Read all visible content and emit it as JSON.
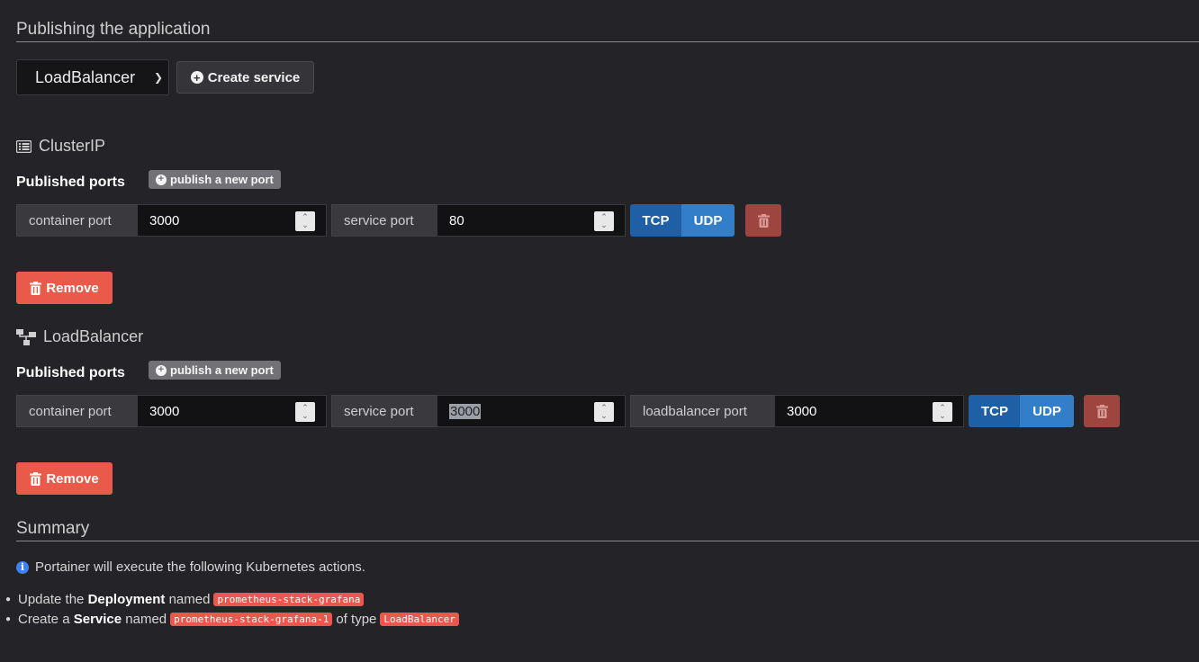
{
  "publishing": {
    "title": "Publishing the application",
    "service_type_selected": "LoadBalancer",
    "create_service_label": "Create service"
  },
  "services": [
    {
      "type": "ClusterIP",
      "icon": "list-icon",
      "published_ports_label": "Published ports",
      "publish_new_port_label": "publish a new port",
      "ports": [
        {
          "container_port_label": "container port",
          "container_port_value": "3000",
          "service_port_label": "service port",
          "service_port_value": "80",
          "tcp_label": "TCP",
          "udp_label": "UDP"
        }
      ],
      "remove_label": "Remove"
    },
    {
      "type": "LoadBalancer",
      "icon": "sitemap-icon",
      "published_ports_label": "Published ports",
      "publish_new_port_label": "publish a new port",
      "ports": [
        {
          "container_port_label": "container port",
          "container_port_value": "3000",
          "service_port_label": "service port",
          "service_port_value": "3000",
          "loadbalancer_port_label": "loadbalancer port",
          "loadbalancer_port_value": "3000",
          "tcp_label": "TCP",
          "udp_label": "UDP"
        }
      ],
      "remove_label": "Remove"
    }
  ],
  "summary": {
    "title": "Summary",
    "info_text": "Portainer will execute the following Kubernetes actions.",
    "actions": [
      {
        "verb": "Update the",
        "kind": "Deployment",
        "named_text": "named",
        "name": "prometheus-stack-grafana"
      },
      {
        "verb": "Create a",
        "kind": "Service",
        "named_text": "named",
        "name": "prometheus-stack-grafana-1",
        "of_type_text": "of type",
        "type": "LoadBalancer"
      }
    ]
  },
  "colors": {
    "background": "#242327",
    "primary_dark": "#1f5fa6",
    "primary": "#337ec9",
    "danger": "#ea5a4b",
    "danger_muted": "#9e4540",
    "badge_gray": "#727176"
  }
}
